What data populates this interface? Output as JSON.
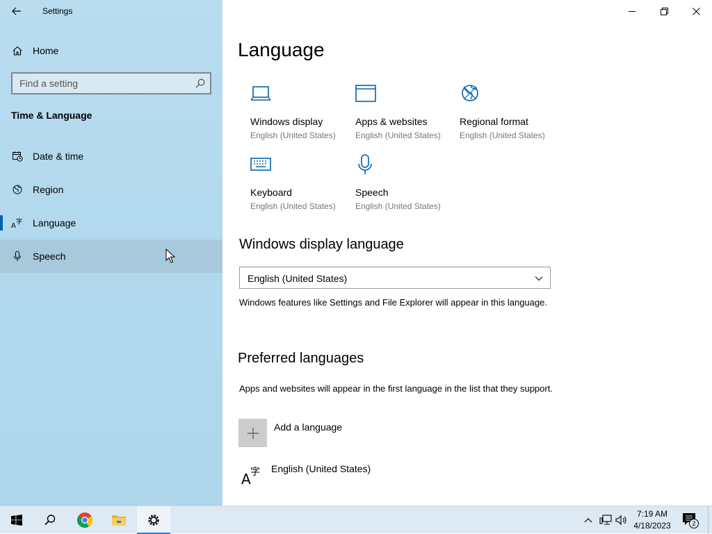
{
  "window": {
    "title": "Settings",
    "controls": {
      "minimize": "minimize",
      "restore": "restore",
      "close": "close"
    }
  },
  "sidebar": {
    "home_label": "Home",
    "search": {
      "placeholder": "Find a setting",
      "value": ""
    },
    "section": "Time & Language",
    "items": [
      {
        "label": "Date & time",
        "icon": "calendar-clock-icon",
        "selected": false
      },
      {
        "label": "Region",
        "icon": "globe-icon",
        "selected": false
      },
      {
        "label": "Language",
        "icon": "language-icon",
        "selected": true
      },
      {
        "label": "Speech",
        "icon": "microphone-icon",
        "selected": false,
        "hover": true
      }
    ]
  },
  "main": {
    "title": "Language",
    "tiles": [
      {
        "label": "Windows display",
        "sub": "English (United States)",
        "icon": "laptop-icon"
      },
      {
        "label": "Apps & websites",
        "sub": "English (United States)",
        "icon": "app-window-icon"
      },
      {
        "label": "Regional format",
        "sub": "English (United States)",
        "icon": "globe-format-icon"
      },
      {
        "label": "Keyboard",
        "sub": "English (United States)",
        "icon": "keyboard-icon"
      },
      {
        "label": "Speech",
        "sub": "English (United States)",
        "icon": "microphone-icon"
      }
    ],
    "display_language": {
      "heading": "Windows display language",
      "selected": "English (United States)",
      "description": "Windows features like Settings and File Explorer will appear in this language."
    },
    "preferred": {
      "heading": "Preferred languages",
      "description": "Apps and websites will appear in the first language in the list that they support.",
      "add_label": "Add a language",
      "languages": [
        {
          "label": "English (United States)"
        }
      ]
    }
  },
  "taskbar": {
    "apps": [
      "start-icon",
      "search-icon",
      "chrome-icon",
      "file-explorer-icon",
      "settings-icon"
    ],
    "active_app": "settings-icon",
    "time": "7:19 AM",
    "date": "4/18/2023",
    "notification_count": "2",
    "colors": {
      "accent": "#0063b1",
      "sidebar": "#b3d9ee"
    }
  }
}
